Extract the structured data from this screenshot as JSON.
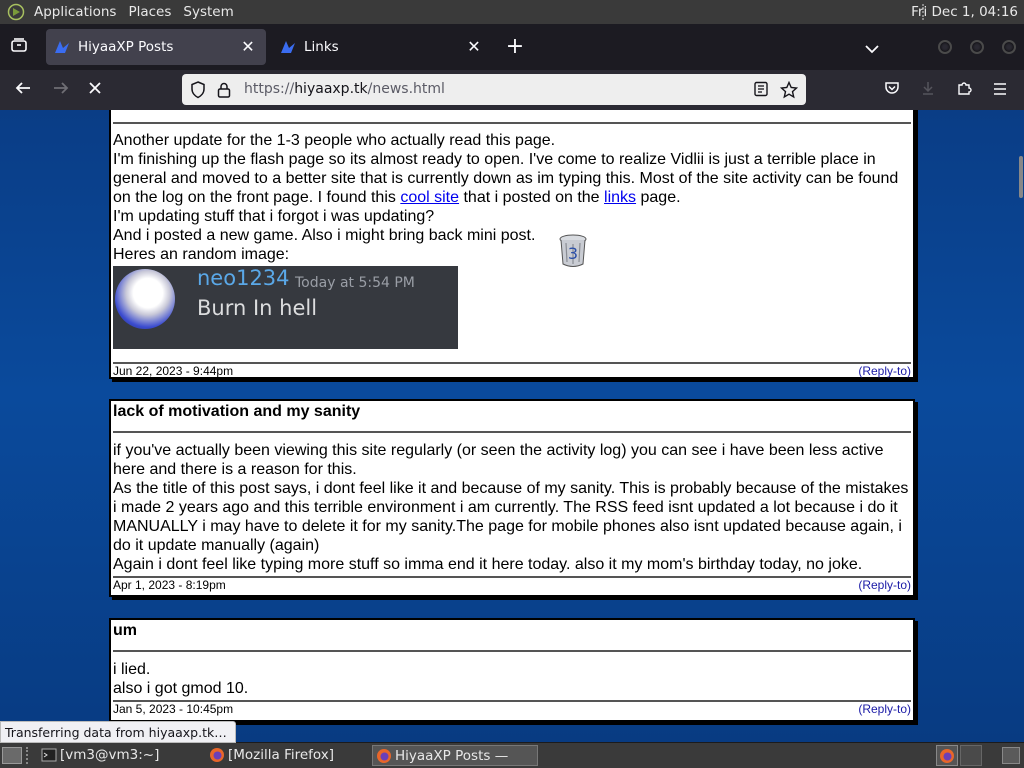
{
  "top_panel": {
    "menus": [
      "Applications",
      "Places",
      "System"
    ],
    "clock": "Fri Dec 1, 04:16"
  },
  "tabs": [
    {
      "label": "HiyaaXP Posts",
      "active": true
    },
    {
      "label": "Links",
      "active": false
    }
  ],
  "navbar": {
    "url_prefix": "https://",
    "url_domain": "hiyaaxp.tk",
    "url_path": "/news.html"
  },
  "posts": [
    {
      "title": "",
      "lines_before_image": {
        "l1": "Another update for the 1-3 people who actually read this page.",
        "l2a": "I'm finishing up the flash page so its almost ready to open. I've come to realize Vidlii is just a terrible place in general and moved to a better site that is currently down as im typing this. Most of the site activity can be found on the log on the front page. I found this ",
        "link1": "cool site",
        "l2b": " that i posted on the ",
        "link2": "links",
        "l2c": " page.",
        "l3": "I'm updating stuff that i forgot i was updating?",
        "l4": "And i posted a new game. Also i might bring back mini post.",
        "l5": "Heres an random image:"
      },
      "image": {
        "username": "neo1234",
        "timestamp": "Today at 5:54 PM",
        "message": "Burn In hell"
      },
      "date": "Jun 22, 2023 - 9:44pm",
      "reply": "Reply-to"
    },
    {
      "title": "lack of motivation and my sanity",
      "body": [
        "if you've actually been viewing this site regularly (or seen the activity log) you can see i have been less active here and there is a reason for this.",
        "As the title of this post says, i dont feel like it and because of my sanity. This is probably because of the mistakes i made 2 years ago and this terrible environment i am currently. The RSS feed isnt updated a lot because i do it MANUALLY i may have to delete it for my sanity.The page for mobile phones also isnt updated because again, i do it update manually (again)",
        "Again i dont feel like typing more stuff so imma end it here today. also it my mom's birthday today, no joke."
      ],
      "date": "Apr 1, 2023 - 8:19pm",
      "reply": "Reply-to"
    },
    {
      "title": "um",
      "body": [
        "i lied.",
        "also i got gmod 10."
      ],
      "date": "Jan 5, 2023 - 10:45pm",
      "reply": "Reply-to"
    }
  ],
  "status_text": "Transferring data from hiyaaxp.tk…",
  "taskbar": [
    {
      "label": "[vm3@vm3:~]"
    },
    {
      "label": "[Mozilla Firefox]"
    },
    {
      "label": "HiyaaXP Posts — M…"
    }
  ]
}
